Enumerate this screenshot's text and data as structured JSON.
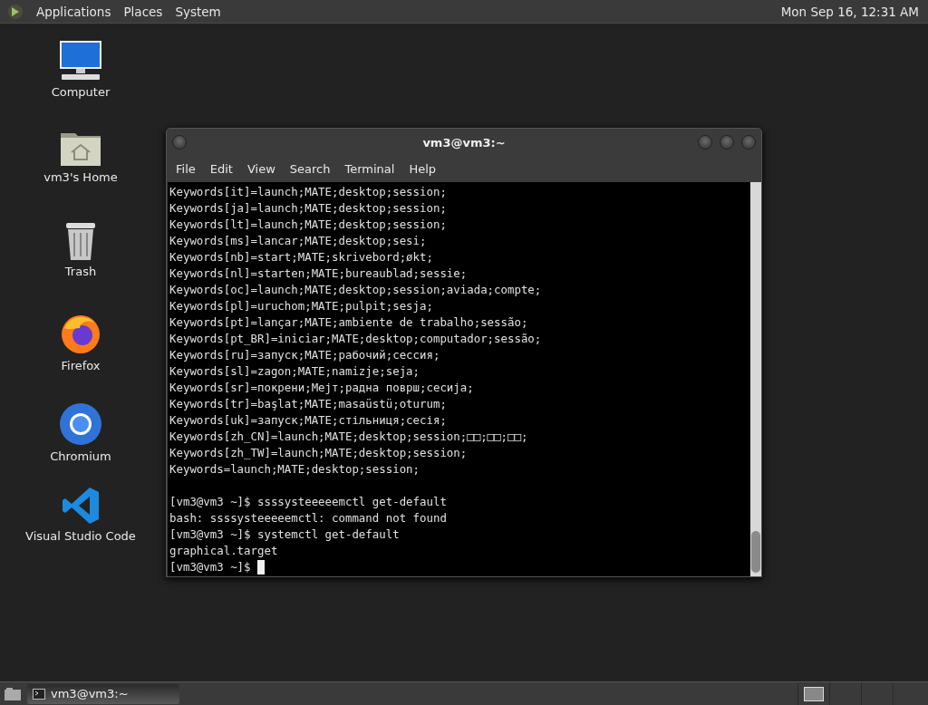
{
  "top_panel": {
    "menus": [
      "Applications",
      "Places",
      "System"
    ],
    "clock": "Mon Sep 16, 12:31 AM"
  },
  "desktop_icons": [
    {
      "kind": "computer",
      "label": "Computer"
    },
    {
      "kind": "home",
      "label": "vm3's Home"
    },
    {
      "kind": "trash",
      "label": "Trash"
    },
    {
      "kind": "firefox",
      "label": "Firefox"
    },
    {
      "kind": "chromium",
      "label": "Chromium"
    },
    {
      "kind": "vscode",
      "label": "Visual Studio Code"
    }
  ],
  "terminal": {
    "title": "vm3@vm3:~",
    "menu": [
      "File",
      "Edit",
      "View",
      "Search",
      "Terminal",
      "Help"
    ],
    "lines": [
      "Keywords[it]=launch;MATE;desktop;session;",
      "Keywords[ja]=launch;MATE;desktop;session;",
      "Keywords[lt]=launch;MATE;desktop;session;",
      "Keywords[ms]=lancar;MATE;desktop;sesi;",
      "Keywords[nb]=start;MATE;skrivebord;økt;",
      "Keywords[nl]=starten;MATE;bureaublad;sessie;",
      "Keywords[oc]=launch;MATE;desktop;session;aviada;compte;",
      "Keywords[pl]=uruchom;MATE;pulpit;sesja;",
      "Keywords[pt]=lançar;MATE;ambiente de trabalho;sessão;",
      "Keywords[pt_BR]=iniciar;MATE;desktop;computador;sessão;",
      "Keywords[ru]=запуск;MATE;рабочий;сессия;",
      "Keywords[sl]=zagon;MATE;namizje;seja;",
      "Keywords[sr]=покрени;Мејт;радна површ;сесија;",
      "Keywords[tr]=başlat;MATE;masaüstü;oturum;",
      "Keywords[uk]=запуск;MATE;стільниця;сесія;",
      "Keywords[zh_CN]=launch;MATE;desktop;session;□□;□□;□□;",
      "Keywords[zh_TW]=launch;MATE;desktop;session;",
      "Keywords=launch;MATE;desktop;session;"
    ],
    "session": [
      "[vm3@vm3 ~]$ ssssysteeeeemctl get-default",
      "bash: ssssysteeeeemctl: command not found",
      "[vm3@vm3 ~]$ systemctl get-default",
      "graphical.target",
      "[vm3@vm3 ~]$"
    ]
  },
  "taskbar": {
    "tasks": [
      {
        "label": "vm3@vm3:~",
        "selected": true
      }
    ]
  }
}
